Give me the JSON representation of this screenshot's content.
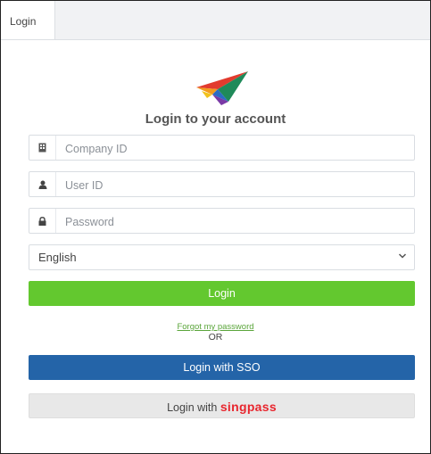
{
  "tabs": [
    {
      "label": "Login"
    }
  ],
  "login": {
    "title": "Login to your account",
    "company_id": {
      "placeholder": "Company ID",
      "icon": "building-icon"
    },
    "user_id": {
      "placeholder": "User ID",
      "icon": "user-icon"
    },
    "password": {
      "placeholder": "Password",
      "icon": "lock-icon"
    },
    "language": {
      "selected": "English"
    },
    "login_button": "Login",
    "forgot_password": "Forgot my password",
    "or_text": "OR",
    "sso_button": "Login with SSO",
    "singpass_prefix": "Login with",
    "singpass_brand": "singpass"
  },
  "colors": {
    "login_green": "#63c82f",
    "sso_blue": "#2464a8",
    "singpass_red": "#e8262e",
    "link_green": "#5aa53a"
  }
}
